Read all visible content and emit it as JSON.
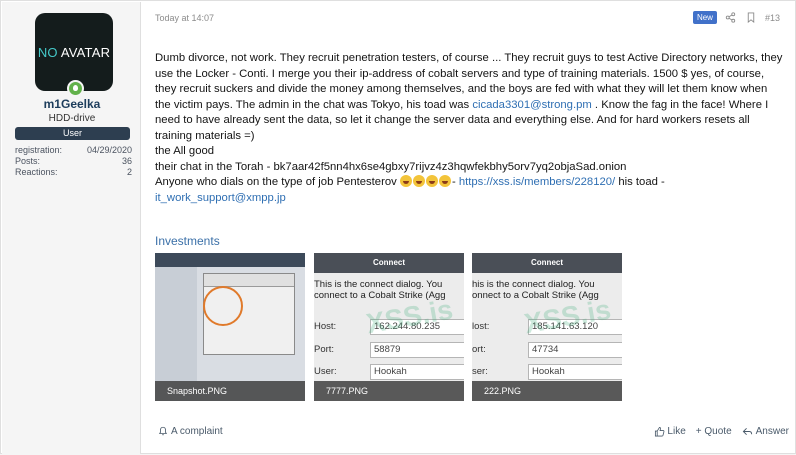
{
  "user": {
    "avatar_text_no": "NO",
    "avatar_text_rest": " AVATAR",
    "name": "m1Geelka",
    "title": "HDD-drive",
    "banner": "User",
    "stats": [
      {
        "label": "registration:",
        "value": "04/29/2020"
      },
      {
        "label": "Posts:",
        "value": "36"
      },
      {
        "label": "Reactions:",
        "value": "2"
      }
    ]
  },
  "post": {
    "date": "Today at 14:07",
    "badge": "New",
    "number": "#13",
    "p1_a": "Dumb divorce, not work. They recruit penetration testers, of course ... They recruit guys to test Active Directory networks, they use the Locker - Conti. I merge you their ip-address of cobalt servers and type of training materials. 1500 $ yes, of course, they recruit suckers and divide the money among themselves, and the boys are fed with what they will let them know when the victim pays. The admin in the chat was Tokyo, his toad was ",
    "p1_link": "cicada3301@strong.pm",
    "p1_b": " . Know the fag in the face! Where I need to have already sent the data, so let it change the server data and everything else. And for hard workers resets all training materials =)",
    "p2": "the All good",
    "p3": "their chat in the Torah - bk7aar42f5nn4hx6se4gbxy7rijvz4z3hqwfekbhy5orv7yq2objaSad.onion",
    "p4_a": "Anyone who dials on the type of job Pentesterov ",
    "p4_b": "- ",
    "p4_link": "https://xss.is/members/228120/",
    "p4_c": " his toad - ",
    "p4_link2": "it_work_support@xmpp.jp",
    "attach_heading": "Investments"
  },
  "attachments": [
    {
      "caption": "Snapshot.PNG"
    },
    {
      "caption": "7777.PNG",
      "title": "Connect",
      "line1": "This is the connect dialog. You",
      "line2": "connect to a Cobalt Strike (Agg",
      "host_label": "Host:",
      "host": "162.244.80.235",
      "port_label": "Port:",
      "port": "58879",
      "user_label": "User:",
      "user": "Hookah",
      "watermark": "XSS.is"
    },
    {
      "caption": "222.PNG",
      "title": "Connect",
      "line1": "his is the connect dialog. You",
      "line2": "onnect to a Cobalt Strike (Agg",
      "host_label": "lost:",
      "host": "185.141.63.120",
      "port_label": "ort:",
      "port": "47734",
      "user_label": "ser:",
      "user": "Hookah",
      "watermark": "XSS.is"
    }
  ],
  "footer": {
    "complaint": "A complaint",
    "like": "Like",
    "quote": "+ Quote",
    "answer": "Answer"
  }
}
